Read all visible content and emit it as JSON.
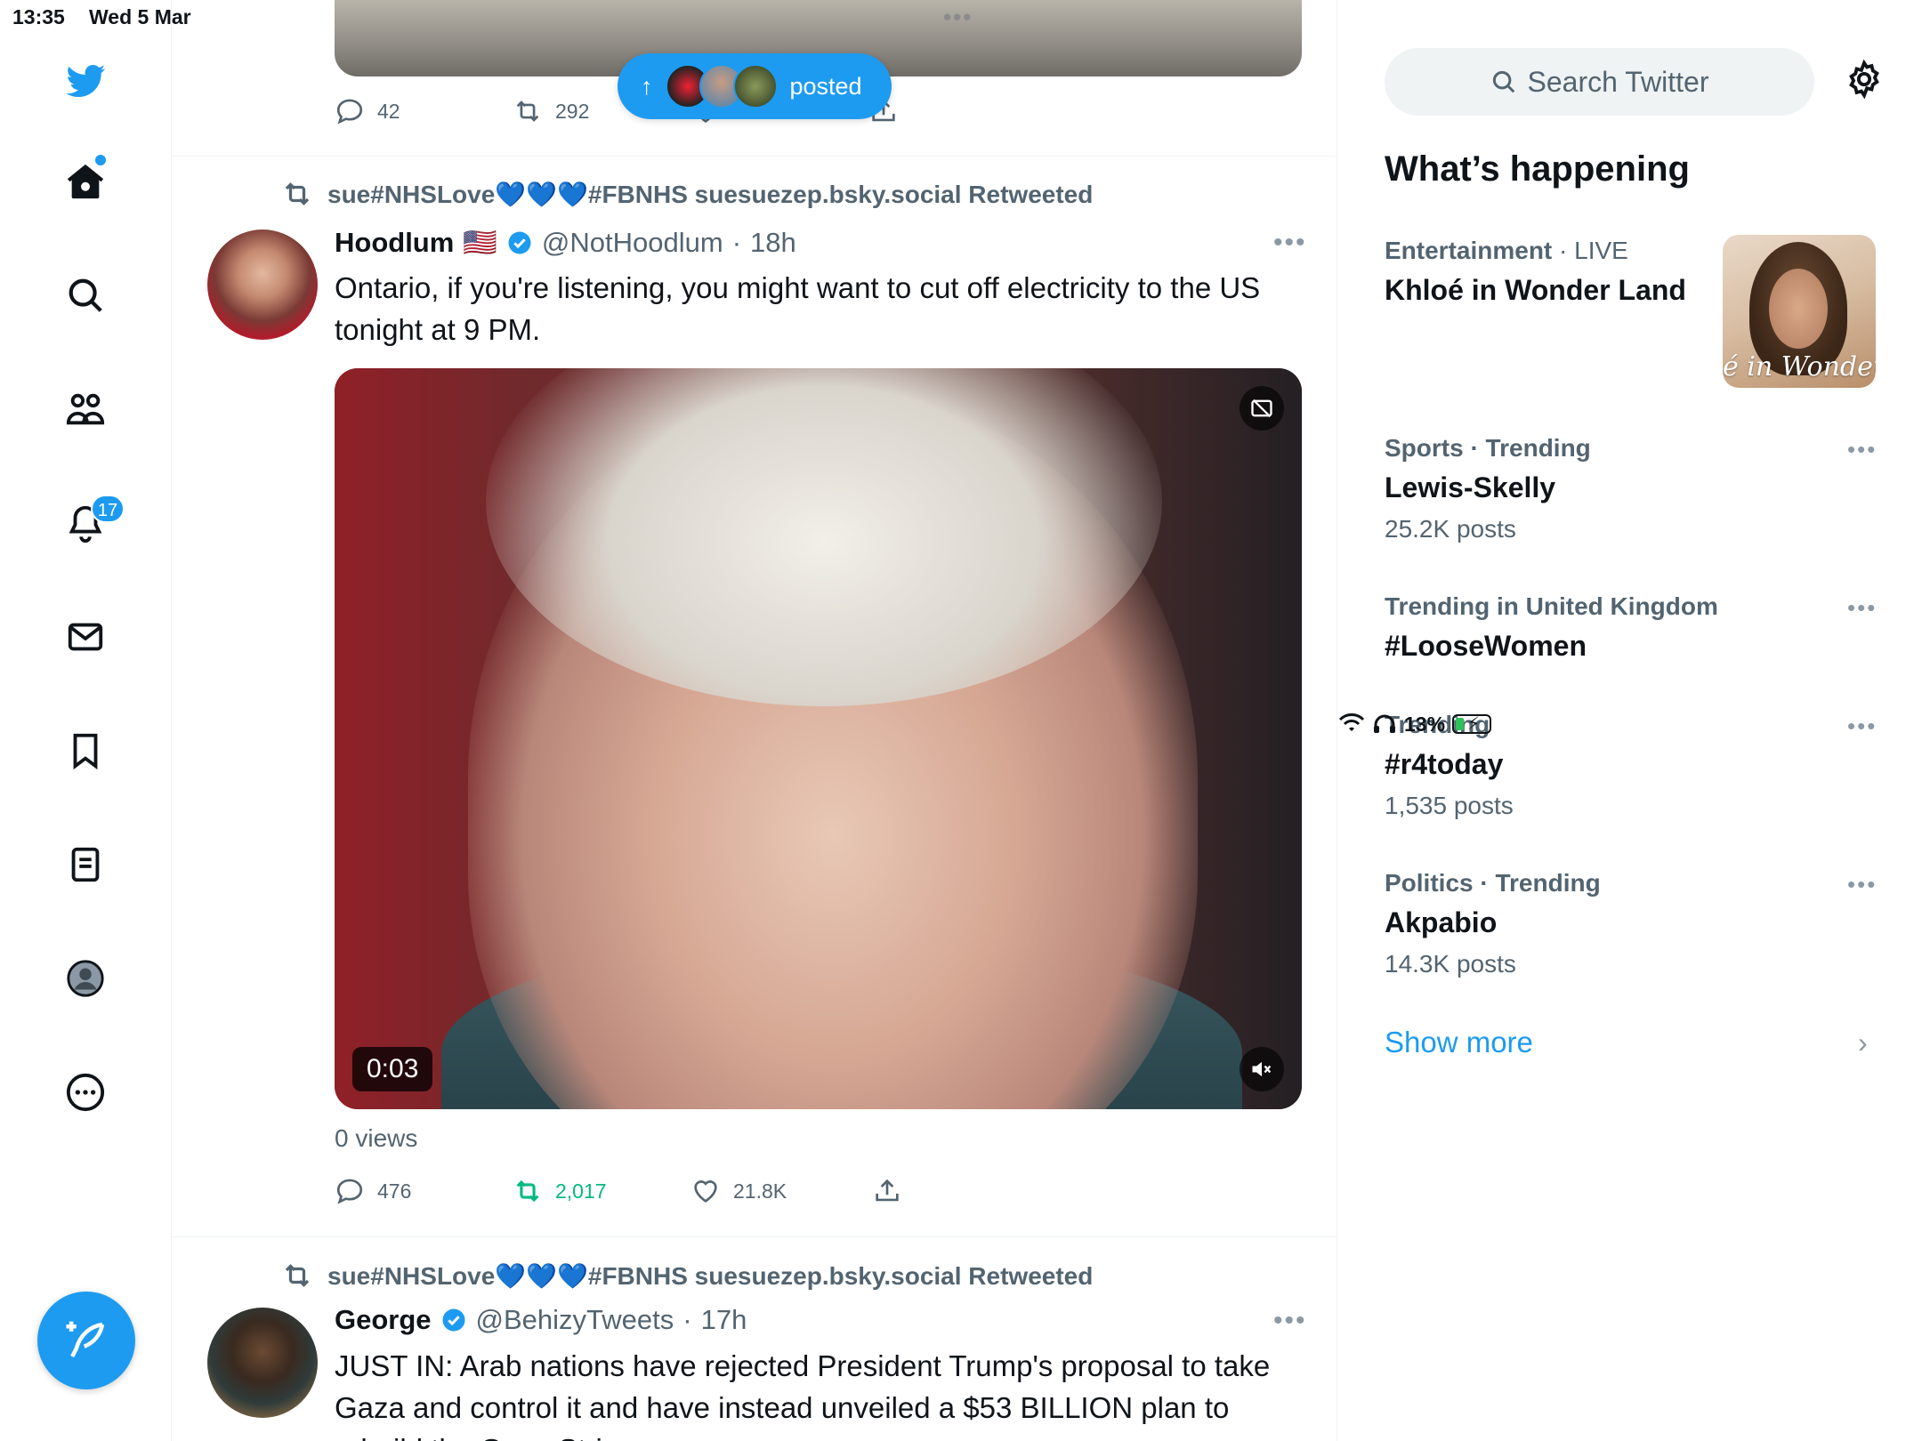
{
  "status": {
    "time": "13:35",
    "date": "Wed 5 Mar",
    "battery": "13%"
  },
  "nav": {
    "notifications_count": "17"
  },
  "feed": {
    "prev_tweet": {
      "replies": "42",
      "retweets": "292"
    },
    "posted_pill": {
      "label": "posted"
    },
    "tweet1": {
      "retweeted_by": "sue#NHSLove💙💙💙#FBNHS suesuezep.bsky.social Retweeted",
      "name": "Hoodlum",
      "flag": "🇺🇸",
      "handle": "@NotHoodlum",
      "time": "18h",
      "text": "Ontario, if you're listening, you might want to cut off electricity to the US tonight at 9 PM.",
      "video_duration": "0:03",
      "views": "0 views",
      "replies": "476",
      "retweets": "2,017",
      "likes": "21.8K"
    },
    "tweet2": {
      "retweeted_by": "sue#NHSLove💙💙💙#FBNHS suesuezep.bsky.social Retweeted",
      "name": "George",
      "handle": "@BehizyTweets",
      "time": "17h",
      "text": "JUST IN: Arab nations have rejected President Trump's proposal to take Gaza and control it and have instead unveiled a $53 BILLION plan to rebuild the Gaza Strip."
    }
  },
  "sidebar": {
    "search_placeholder": "Search Twitter",
    "whats_happening": "What’s happening",
    "trends": [
      {
        "category": "Entertainment",
        "sub": "LIVE",
        "topic": "Khloé in Wonder Land",
        "count": "",
        "image_text": "é in Wonder L"
      },
      {
        "category": "Sports · Trending",
        "sub": "",
        "topic": "Lewis-Skelly",
        "count": "25.2K posts"
      },
      {
        "category": "Trending in United Kingdom",
        "sub": "",
        "topic": "#LooseWomen",
        "count": ""
      },
      {
        "category": "Trending",
        "sub": "",
        "topic": "#r4today",
        "count": "1,535 posts"
      },
      {
        "category": "Politics · Trending",
        "sub": "",
        "topic": "Akpabio",
        "count": "14.3K posts"
      }
    ],
    "show_more": "Show more"
  },
  "colors": {
    "accent": "#1d9bf0",
    "retweet_green": "#00ba7c",
    "muted": "#536471"
  }
}
